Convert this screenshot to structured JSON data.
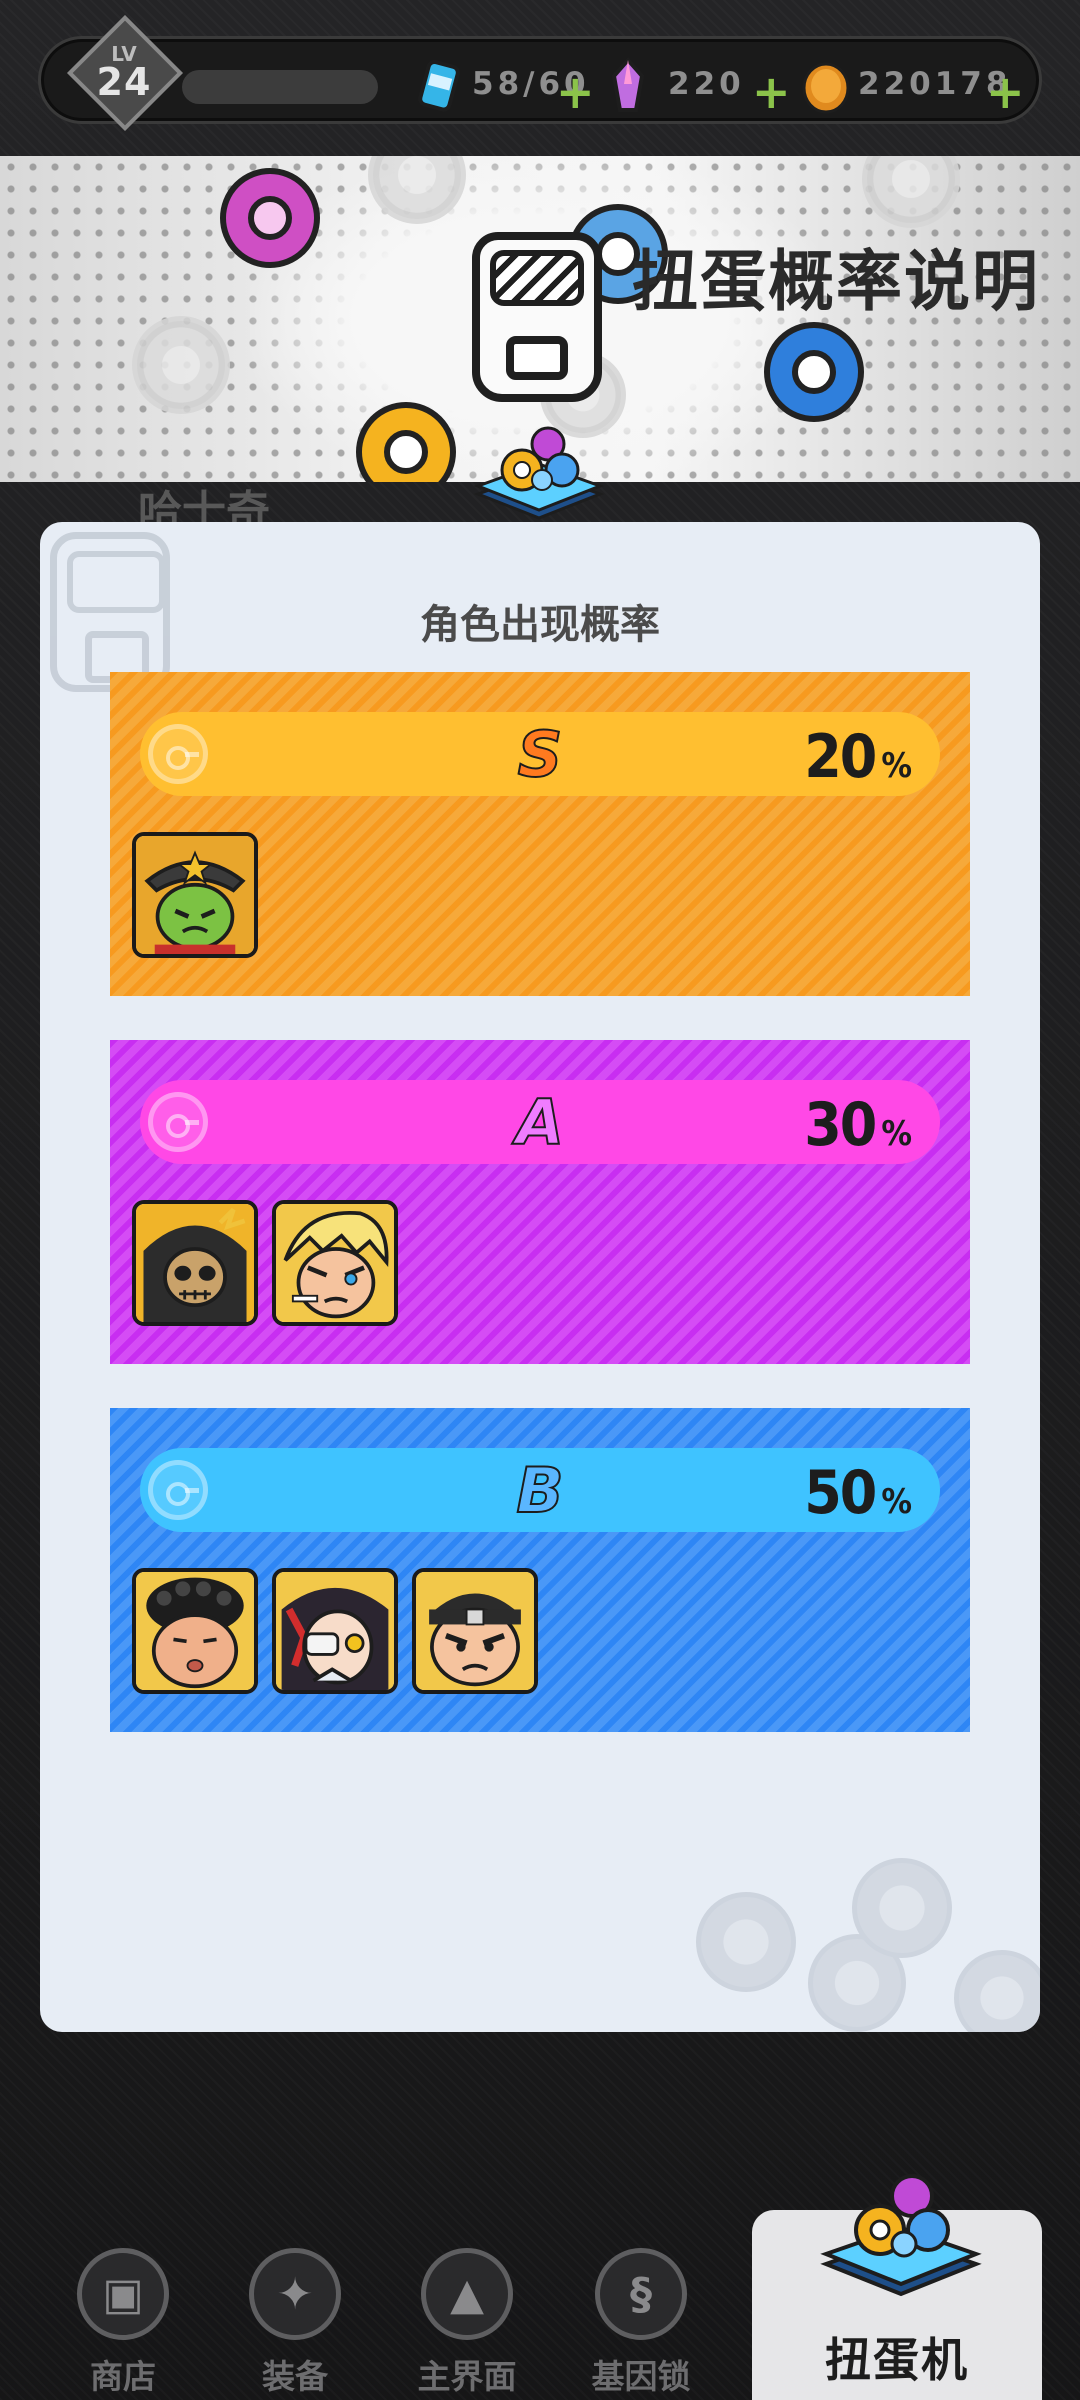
{
  "player": {
    "level_label": "LV",
    "level": "24"
  },
  "resources": [
    {
      "name": "energy",
      "icon": "energy-can-icon",
      "value": "58/60"
    },
    {
      "name": "gems",
      "icon": "crystal-icon",
      "value": "220"
    },
    {
      "name": "coins",
      "icon": "coin-icon",
      "value": "220178"
    }
  ],
  "banner": {
    "title": "扭蛋概率说明",
    "bg_name": "哈士奇"
  },
  "panel": {
    "title": "角色出现概率",
    "tiers": [
      {
        "grade": "S",
        "percent": "20",
        "percent_sign": "%",
        "color": "#f79a1f",
        "characters": [
          "cactus-sheriff"
        ]
      },
      {
        "grade": "A",
        "percent": "30",
        "percent_sign": "%",
        "color": "#c82ef1",
        "characters": [
          "skull-reaper",
          "blond-smoker"
        ]
      },
      {
        "grade": "B",
        "percent": "50",
        "percent_sign": "%",
        "color": "#2e86f5",
        "characters": [
          "curly-man",
          "eyepatch-girl",
          "headband-man"
        ]
      }
    ]
  },
  "nav": {
    "items": [
      {
        "label": "商店",
        "icon": "shop-icon"
      },
      {
        "label": "装备",
        "icon": "equipment-icon"
      },
      {
        "label": "主界面",
        "icon": "home-icon"
      },
      {
        "label": "基因锁",
        "icon": "dna-icon"
      }
    ],
    "active": {
      "label": "扭蛋机",
      "icon": "gacha-machine-icon"
    }
  }
}
